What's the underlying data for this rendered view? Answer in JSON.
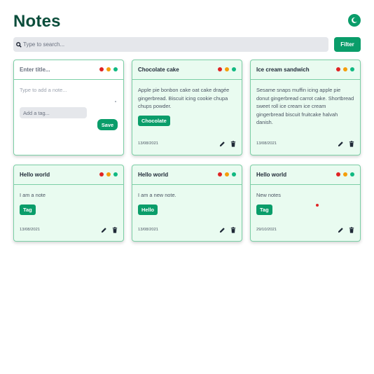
{
  "app": {
    "title": "Notes",
    "theme_toggle_icon": "moon-icon"
  },
  "search": {
    "placeholder": "Type to search...",
    "value": "",
    "icon": "search-icon"
  },
  "filter": {
    "label": "Filter"
  },
  "colors": {
    "accent": "#0a9d6a",
    "title": "#0b4d3b",
    "card_bg": "#e9fbf0",
    "card_border": "#7ccfa6",
    "dot_red": "#e02424",
    "dot_orange": "#f59e0b",
    "dot_green": "#10b981"
  },
  "new_note": {
    "title_placeholder": "Enter title...",
    "body_placeholder": "Type to add a note...",
    "tag_placeholder": "Add a tag...",
    "save_label": "Save"
  },
  "notes": [
    {
      "title": "Chocolate cake",
      "body": "Apple pie bonbon cake oat cake dragée gingerbread. Biscuit icing cookie chupa chups powder.",
      "tag": "Chocolate",
      "date": "13/08/2021"
    },
    {
      "title": "Ice cream sandwich",
      "body": "Sesame snaps muffin icing apple pie donut gingerbread carrot cake. Shortbread sweet roll ice cream ice cream gingerbread biscuit fruitcake halvah danish.",
      "tag": "",
      "date": "13/08/2021"
    },
    {
      "title": "Hello world",
      "body": "I am a note",
      "tag": "Tag",
      "date": "13/08/2021"
    },
    {
      "title": "Hello world",
      "body": "I am a new note.",
      "tag": "Hello",
      "date": "13/08/2021"
    },
    {
      "title": "Hello world",
      "body": "New notes",
      "tag": "Tag",
      "date": "29/10/2021"
    }
  ]
}
